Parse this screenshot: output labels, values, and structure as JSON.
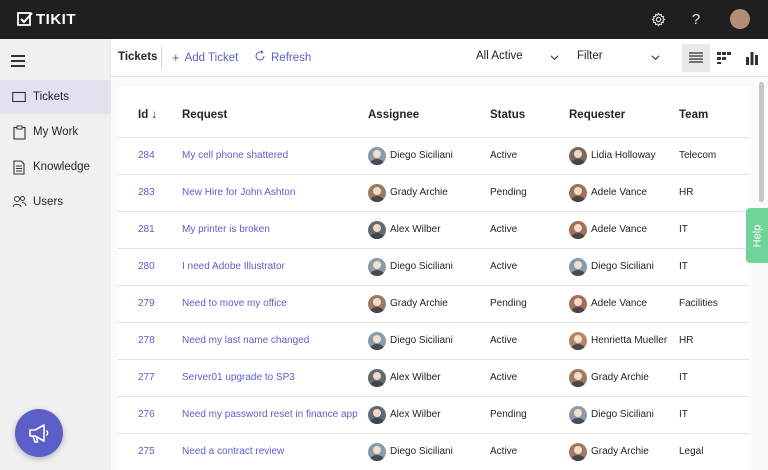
{
  "app": {
    "name": "TIKIT"
  },
  "sidebar": {
    "items": [
      {
        "label": "Tickets",
        "icon": "ticket-icon",
        "active": true
      },
      {
        "label": "My Work",
        "icon": "clipboard-icon",
        "active": false
      },
      {
        "label": "Knowledge",
        "icon": "document-icon",
        "active": false
      },
      {
        "label": "Users",
        "icon": "users-icon",
        "active": false
      }
    ]
  },
  "toolbar": {
    "title": "Tickets",
    "add_label": "Add Ticket",
    "refresh_label": "Refresh",
    "view_filter": "All Active",
    "filter_label": "Filter"
  },
  "table": {
    "headers": {
      "id": "Id ↓",
      "request": "Request",
      "assignee": "Assignee",
      "status": "Status",
      "requester": "Requester",
      "team": "Team"
    },
    "rows": [
      {
        "id": "284",
        "request": "My cell phone shattered",
        "assignee": "Diego Siciliani",
        "status": "Active",
        "requester": "Lidia Holloway",
        "team": "Telecom"
      },
      {
        "id": "283",
        "request": "New Hire for John Ashton",
        "assignee": "Grady Archie",
        "status": "Pending",
        "requester": "Adele Vance",
        "team": "HR"
      },
      {
        "id": "281",
        "request": "My printer is broken",
        "assignee": "Alex Wilber",
        "status": "Active",
        "requester": "Adele Vance",
        "team": "IT"
      },
      {
        "id": "280",
        "request": "I need Adobe Illustrator",
        "assignee": "Diego Siciliani",
        "status": "Active",
        "requester": "Diego Siciliani",
        "team": "IT"
      },
      {
        "id": "279",
        "request": "Need to move my office",
        "assignee": "Grady Archie",
        "status": "Pending",
        "requester": "Adele Vance",
        "team": "Facilities"
      },
      {
        "id": "278",
        "request": "Need my last name changed",
        "assignee": "Diego Siciliani",
        "status": "Active",
        "requester": "Henrietta Mueller",
        "team": "HR"
      },
      {
        "id": "277",
        "request": "Server01 upgrade to SP3",
        "assignee": "Alex Wilber",
        "status": "Active",
        "requester": "Grady Archie",
        "team": "IT"
      },
      {
        "id": "276",
        "request": "Need my password reset in finance app",
        "assignee": "Alex Wilber",
        "status": "Pending",
        "requester": "Diego Siciliani",
        "team": "IT"
      },
      {
        "id": "275",
        "request": "Need a contract review",
        "assignee": "Diego Siciliani",
        "status": "Active",
        "requester": "Grady Archie",
        "team": "Legal"
      }
    ]
  },
  "help": {
    "label": "Help"
  },
  "colors": {
    "accent": "#5b5fc7",
    "topbar": "#1f1f1f",
    "help": "#6fd39a"
  },
  "avatar_colors": {
    "Diego Siciliani": "#8a9aa8",
    "Grady Archie": "#9b7b62",
    "Alex Wilber": "#5f6a72",
    "Lidia Holloway": "#7a6a60",
    "Adele Vance": "#a0705a",
    "Henrietta Mueller": "#b3866a"
  }
}
